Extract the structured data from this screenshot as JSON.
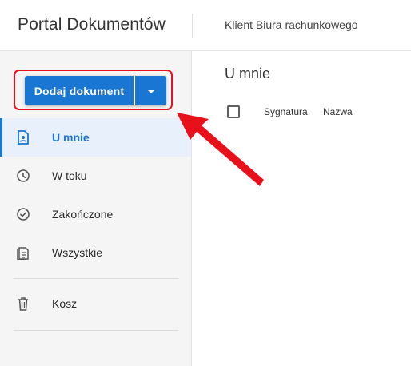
{
  "header": {
    "app_title": "Portal Dokumentów",
    "client_name": "Klient Biura rachunkowego"
  },
  "sidebar": {
    "add_button_label": "Dodaj dokument",
    "items": [
      {
        "label": "U mnie",
        "icon": "person-document-icon",
        "active": true
      },
      {
        "label": "W toku",
        "icon": "clock-icon",
        "active": false
      },
      {
        "label": "Zakończone",
        "icon": "check-circle-icon",
        "active": false
      },
      {
        "label": "Wszystkie",
        "icon": "documents-icon",
        "active": false
      },
      {
        "label": "Kosz",
        "icon": "trash-icon",
        "active": false
      }
    ]
  },
  "main": {
    "title": "U mnie",
    "columns": [
      "Sygnatura",
      "Nazwa"
    ]
  },
  "colors": {
    "accent": "#1976d2",
    "annotation": "#e8101a",
    "active_bg": "#e8f1fb"
  }
}
